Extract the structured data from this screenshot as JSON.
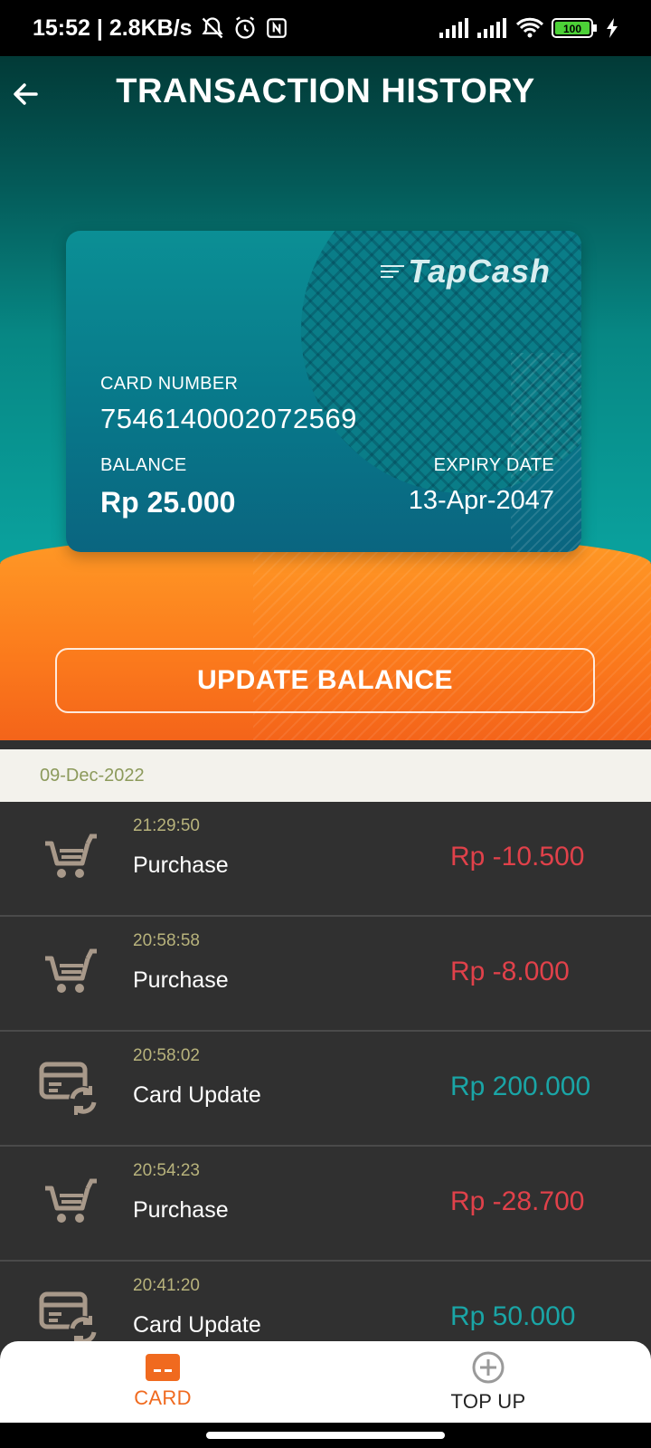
{
  "status_bar": {
    "time_speed": "15:52 | 2.8KB/s",
    "battery": "100"
  },
  "header": {
    "title": "TRANSACTION HISTORY"
  },
  "card": {
    "brand": "TapCash",
    "number_label": "CARD NUMBER",
    "number": "7546140002072569",
    "balance_label": "BALANCE",
    "balance": "Rp 25.000",
    "expiry_label": "EXPIRY DATE",
    "expiry": "13-Apr-2047"
  },
  "update_button": "UPDATE BALANCE",
  "history": {
    "date": "09-Dec-2022",
    "transactions": [
      {
        "time": "21:29:50",
        "type": "Purchase",
        "amount": "Rp -10.500",
        "icon": "cart-icon"
      },
      {
        "time": "20:58:58",
        "type": "Purchase",
        "amount": "Rp -8.000",
        "icon": "cart-icon"
      },
      {
        "time": "20:58:02",
        "type": "Card Update",
        "amount": "Rp 200.000",
        "icon": "card-update-icon"
      },
      {
        "time": "20:54:23",
        "type": "Purchase",
        "amount": "Rp -28.700",
        "icon": "cart-icon"
      },
      {
        "time": "20:41:20",
        "type": "Card Update",
        "amount": "Rp 50.000",
        "icon": "card-update-icon"
      }
    ]
  },
  "bottom_nav": {
    "card_label": "CARD",
    "topup_label": "TOP UP"
  },
  "colors": {
    "accent_orange": "#f06a1f",
    "negative": "#e0414a",
    "positive": "#1aa5a6"
  }
}
